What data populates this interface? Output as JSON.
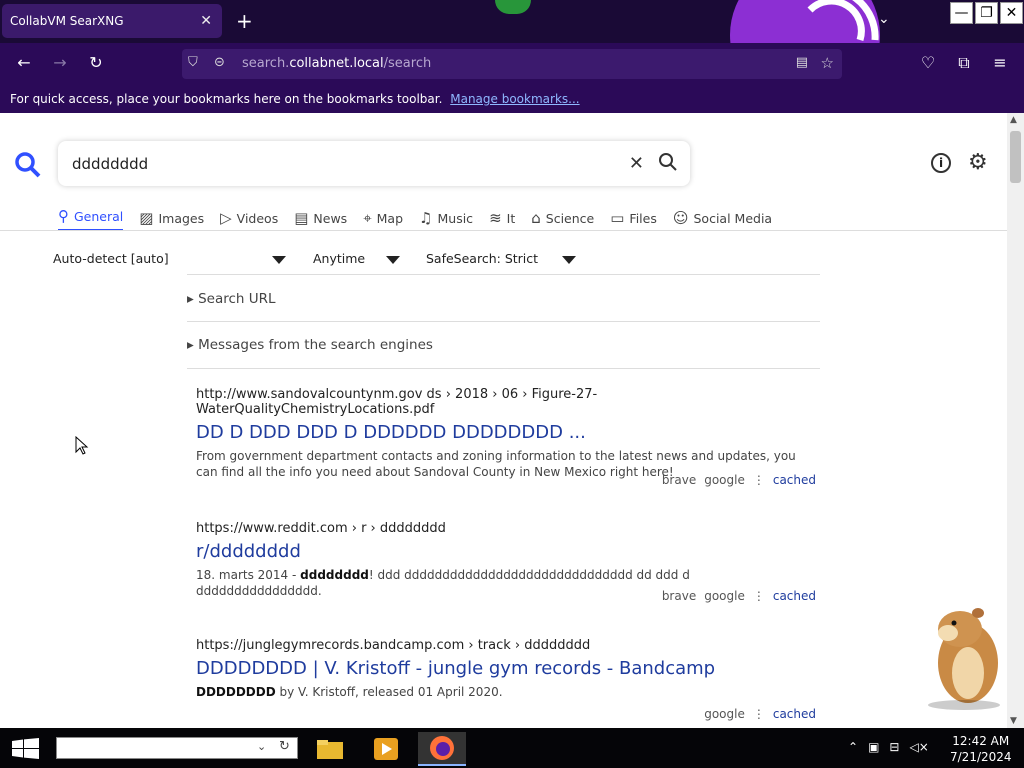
{
  "browser": {
    "tab_title": "CollabVM SearXNG",
    "tab_close": "✕",
    "new_tab": "+",
    "url_host_prefix": "search.",
    "url_host": "collabnet.local",
    "url_path": "/search",
    "bookmarks_text": "For quick access, place your bookmarks here on the bookmarks toolbar.",
    "bookmarks_link": "Manage bookmarks..."
  },
  "search": {
    "query": "dddddddd",
    "categories": [
      {
        "label": "General",
        "icon": "search-icon",
        "active": true
      },
      {
        "label": "Images",
        "icon": "image-icon"
      },
      {
        "label": "Videos",
        "icon": "play-icon"
      },
      {
        "label": "News",
        "icon": "newspaper-icon"
      },
      {
        "label": "Map",
        "icon": "pin-icon"
      },
      {
        "label": "Music",
        "icon": "music-icon"
      },
      {
        "label": "It",
        "icon": "layers-icon"
      },
      {
        "label": "Science",
        "icon": "school-icon"
      },
      {
        "label": "Files",
        "icon": "files-icon"
      },
      {
        "label": "Social Media",
        "icon": "people-icon"
      }
    ],
    "filters": {
      "language": "Auto-detect [auto]",
      "time": "Anytime",
      "safesearch": "SafeSearch: Strict"
    },
    "search_url_label": "Search URL",
    "messages_label": "Messages from the search engines"
  },
  "results": [
    {
      "url": "http://www.sandovalcountynm.gov  ds › 2018 › 06 › Figure-27-WaterQualityChemistryLocations.pdf",
      "title": "DD D DDD DDD D DDDDDD DDDDDDDD ...",
      "snippet": "From government department contacts and zoning information to the latest news and updates, you can find all the info you need about Sandoval County in New Mexico right here!",
      "engines": [
        "brave",
        "google"
      ],
      "cached": "cached"
    },
    {
      "url": "https://www.reddit.com  › r › dddddddd",
      "title": "r/dddddddd",
      "snippet_prefix": "18. marts 2014 - ",
      "snippet_bold": "dddddddd",
      "snippet_rest": "! ddd dddddddddddddddddddddddddddddd dd ddd d dddddddddddddddd.",
      "engines": [
        "brave",
        "google"
      ],
      "cached": "cached"
    },
    {
      "url": "https://junglegymrecords.bandcamp.com  › track › dddddddd",
      "title": "DDDDDDDD | V. Kristoff - jungle gym records - Bandcamp",
      "snippet_bold": "DDDDDDDD",
      "snippet_rest": " by V. Kristoff, released 01 April 2020.",
      "engines": [
        "google"
      ],
      "cached": "cached"
    }
  ],
  "taskbar": {
    "time": "12:42 AM",
    "date": "7/21/2024"
  },
  "colors": {
    "accent": "#3050ff",
    "browser_bg": "#2b0a58",
    "link": "#1f3c9e"
  }
}
